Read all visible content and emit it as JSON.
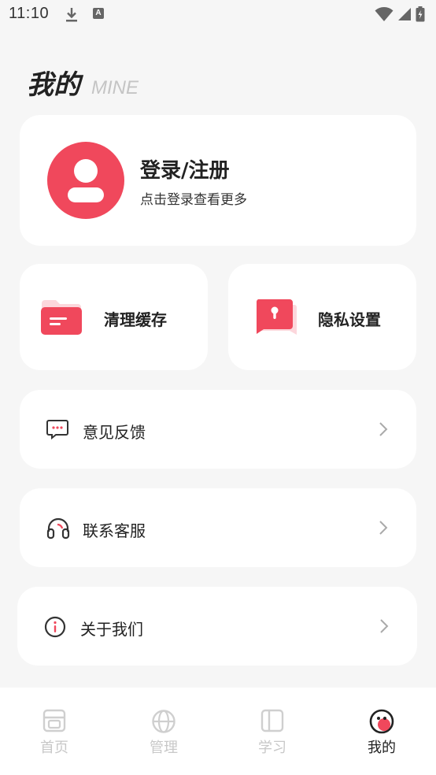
{
  "status_bar": {
    "time": "11:10",
    "icons": [
      "download-icon",
      "a-letter-icon",
      "wifi-icon",
      "signal-icon",
      "battery-charging-icon"
    ]
  },
  "header": {
    "title": "我的",
    "subtitle": "MINE"
  },
  "profile": {
    "login_title": "登录/注册",
    "login_subtitle": "点击登录查看更多",
    "avatar_color": "#f0485c"
  },
  "quick_actions": [
    {
      "label": "清理缓存",
      "icon": "folder-clear-icon"
    },
    {
      "label": "隐私设置",
      "icon": "privacy-lock-icon"
    }
  ],
  "menu": [
    {
      "label": "意见反馈",
      "icon": "feedback-chat-icon"
    },
    {
      "label": "联系客服",
      "icon": "headset-icon"
    },
    {
      "label": "关于我们",
      "icon": "info-icon"
    }
  ],
  "tabs": [
    {
      "label": "首页",
      "icon": "home-icon",
      "active": false
    },
    {
      "label": "管理",
      "icon": "globe-icon",
      "active": false
    },
    {
      "label": "学习",
      "icon": "book-icon",
      "active": false
    },
    {
      "label": "我的",
      "icon": "profile-face-icon",
      "active": true
    }
  ],
  "colors": {
    "accent": "#f0485c",
    "background": "#f6f6f6",
    "card": "#ffffff",
    "inactive_tab": "#c8c8c8"
  }
}
